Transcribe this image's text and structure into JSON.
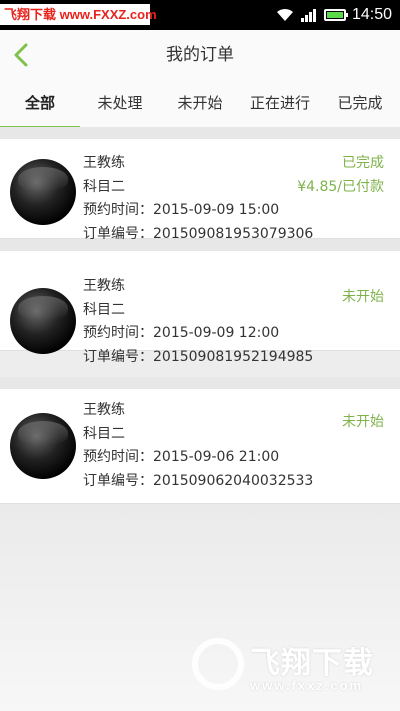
{
  "status_bar": {
    "watermark": "飞翔下载 www.FXXZ.com",
    "time": "14:50"
  },
  "header": {
    "title": "我的订单"
  },
  "tabs": [
    {
      "label": "全部",
      "active": true
    },
    {
      "label": "未处理",
      "active": false
    },
    {
      "label": "未开始",
      "active": false
    },
    {
      "label": "正在进行",
      "active": false
    },
    {
      "label": "已完成",
      "active": false
    }
  ],
  "orders": [
    {
      "coach": "王教练",
      "subject": "科目二",
      "time": "预约时间：2015-09-09 15:00",
      "number": "订单编号：2015090819530793 06",
      "status": "已完成",
      "payment": "¥4.85/已付款"
    },
    {
      "coach": "王教练",
      "subject": "科目二",
      "time": "预约时间：2015-09-09 12:00",
      "number": "订单编号：201509081952194985",
      "status": "未开始",
      "payment": ""
    },
    {
      "coach": "王教练",
      "subject": "科目二",
      "time": "预约时间：2015-09-06 21:00",
      "number": "订单编号：201509062040032533",
      "status": "未开始",
      "payment": ""
    }
  ],
  "watermark_brand": {
    "name": "飞翔下载",
    "url": "www.fxxz.com"
  },
  "colors": {
    "accent": "#7fb34a",
    "background": "#ededed"
  }
}
